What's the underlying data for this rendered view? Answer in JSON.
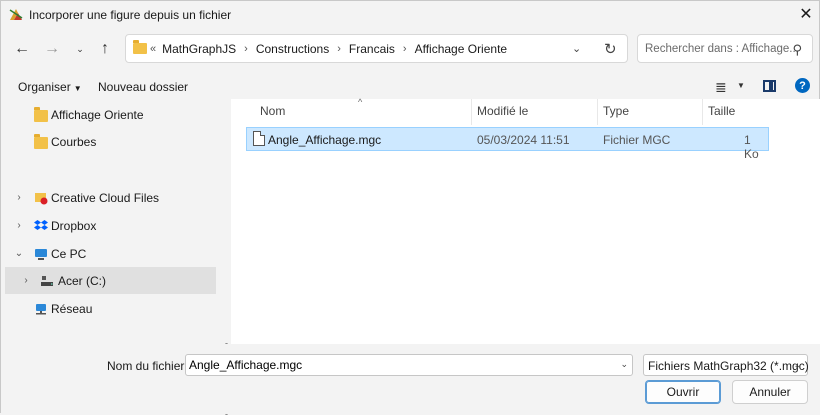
{
  "window": {
    "title": "Incorporer une figure depuis un fichier"
  },
  "nav": {
    "back_icon": "arrow-left-icon",
    "forward_icon": "arrow-right-icon",
    "up_icon": "arrow-up-icon"
  },
  "address": {
    "lead": "«",
    "crumbs": [
      "MathGraphJS",
      "Constructions",
      "Francais",
      "Affichage Oriente"
    ]
  },
  "search": {
    "placeholder": "Rechercher dans : Affichage..."
  },
  "toolbar": {
    "organize_label": "Organiser",
    "new_folder_label": "Nouveau dossier"
  },
  "sidebar": {
    "items": [
      {
        "label": "Affichage Oriente",
        "icon": "folder-icon"
      },
      {
        "label": "Courbes",
        "icon": "folder-icon"
      },
      {
        "label": "Creative Cloud Files",
        "icon": "creative-cloud-icon"
      },
      {
        "label": "Dropbox",
        "icon": "dropbox-icon"
      },
      {
        "label": "Ce PC",
        "icon": "pc-icon"
      },
      {
        "label": "Acer (C:)",
        "icon": "drive-icon"
      },
      {
        "label": "Réseau",
        "icon": "network-icon"
      }
    ]
  },
  "columns": {
    "name": "Nom",
    "modified": "Modifié le",
    "type": "Type",
    "size": "Taille"
  },
  "files": [
    {
      "name": "Angle_Affichage.mgc",
      "modified": "05/03/2024 11:51",
      "type": "Fichier MGC",
      "size": "1 Ko"
    }
  ],
  "footer": {
    "filename_label": "Nom du fichier :",
    "filename_value": "Angle_Affichage.mgc",
    "filter_value": "Fichiers MathGraph32 (*.mgc)",
    "open_label": "Ouvrir",
    "cancel_label": "Annuler"
  },
  "colors": {
    "selection": "#cde8ff",
    "selection_border": "#99d1ff",
    "accent": "#0067c0",
    "folder": "#f2c148"
  }
}
